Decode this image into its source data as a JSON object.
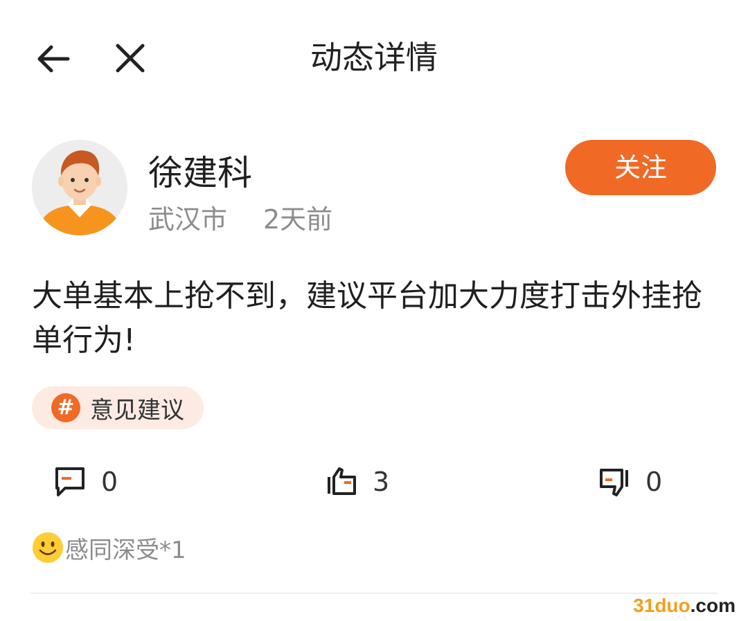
{
  "header": {
    "title": "动态详情",
    "back_icon": "back-arrow-icon",
    "close_icon": "close-icon"
  },
  "post": {
    "author": {
      "name": "徐建科",
      "location": "武汉市",
      "time": "2天前",
      "avatar": "avatar"
    },
    "follow_label": "关注",
    "text": "大单基本上抢不到，建议平台加大力度打击外挂抢单行为!",
    "topic": {
      "icon": "hashtag-icon",
      "label": "意见建议"
    },
    "actions": {
      "comment": {
        "icon": "comment-icon",
        "count": "0"
      },
      "like": {
        "icon": "thumbs-up-icon",
        "count": "3"
      },
      "dislike": {
        "icon": "thumbs-down-icon",
        "count": "0"
      }
    },
    "reaction": {
      "icon": "smile-emoji-icon",
      "text": "感同深受*1"
    }
  },
  "watermark": {
    "part1": "31duo",
    "part2": ".com"
  },
  "colors": {
    "accent": "#f06a26",
    "chip_bg": "#fdebe3",
    "muted_text": "#8c8c8c"
  }
}
